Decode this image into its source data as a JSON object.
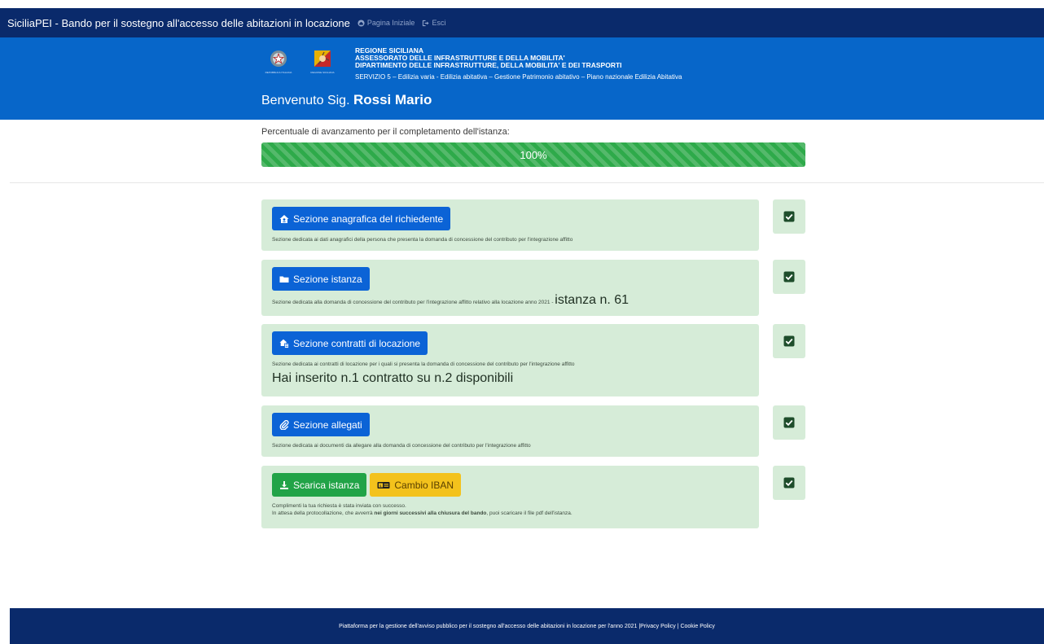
{
  "navbar": {
    "brand": "SiciliaPEI - Bando per il sostegno all'accesso delle abitazioni in locazione",
    "home_label": "Pagina Iniziale",
    "exit_label": "Esci"
  },
  "header": {
    "logo_left_caption": "REPUBBLICA ITALIANA",
    "logo_right_caption": "REGIONE SICILIANA",
    "line1": "REGIONE SICILIANA",
    "line2": "ASSESSORATO DELLE INFRASTRUTTURE E DELLA MOBILITA'",
    "line3": "DIPARTIMENTO DELLE INFRASTRUTTURE, DELLA MOBILITA' E DEI TRASPORTI",
    "line4": "SERVIZIO 5 – Edilizia varia - Edilizia abitativa – Gestione Patrimonio abitativo – Piano nazionale Edilizia Abitativa",
    "welcome_prefix": "Benvenuto Sig.",
    "user_name": "Rossi Mario"
  },
  "progress": {
    "label": "Percentuale di avanzamento per il completamento dell'istanza:",
    "value_text": "100%",
    "value": 1.0
  },
  "sections": {
    "anagrafica": {
      "button": "Sezione anagrafica del richiedente",
      "desc": "Sezione dedicata ai dati anagrafici della persona che presenta la domanda di concessione del contributo per l'integrazione affitto"
    },
    "istanza": {
      "button": "Sezione istanza",
      "desc": "Sezione dedicata alla domanda di concessione del contributo per l'integrazione affitto relativo alla locazione anno 2021 - ",
      "highlight": "istanza n. 61"
    },
    "contratti": {
      "button": "Sezione contratti di locazione",
      "desc": "Sezione dedicata ai contratti di locazione per i quali si presenta la domanda di concessione del contributo per l'integrazione affitto",
      "highlight": "Hai inserito n.1 contratto su n.2 disponibili"
    },
    "allegati": {
      "button": "Sezione allegati",
      "desc": "Sezione dedicata ai documenti da allegare alla domanda di concessione del contributo per l'integrazione affitto"
    },
    "finale": {
      "download_button": "Scarica istanza",
      "iban_button": "Cambio IBAN",
      "msg1": "Complimenti la tua richiesta è stata inviata con successo.",
      "msg2_prefix": "In attesa della protocollazione, che avverrà ",
      "msg2_bold": "nei giorni successivi alla chiusura del bando",
      "msg2_suffix": ", puoi scaricare il file pdf dell'istanza."
    }
  },
  "footer": {
    "text": "Piattaforma per la gestione dell'avviso pubblico per il sostegno all'accesso delle abitazioni in locazione per l'anno 2021 | ",
    "privacy_link": "Privacy Policy",
    "separator": " | ",
    "cookie_link": "Cookie Policy"
  },
  "colors": {
    "navbar": "#0a2a6b",
    "header": "#0766c9",
    "success": "#2eaa4a",
    "card_bg": "#d6ecd8",
    "button_primary": "#0b63d6",
    "button_warning": "#f3c21c"
  },
  "icons": [
    "home-icon",
    "logout-icon",
    "user-home-icon",
    "folder-icon",
    "contract-home-icon",
    "paperclip-icon",
    "download-icon",
    "money-icon",
    "check-square-icon"
  ]
}
